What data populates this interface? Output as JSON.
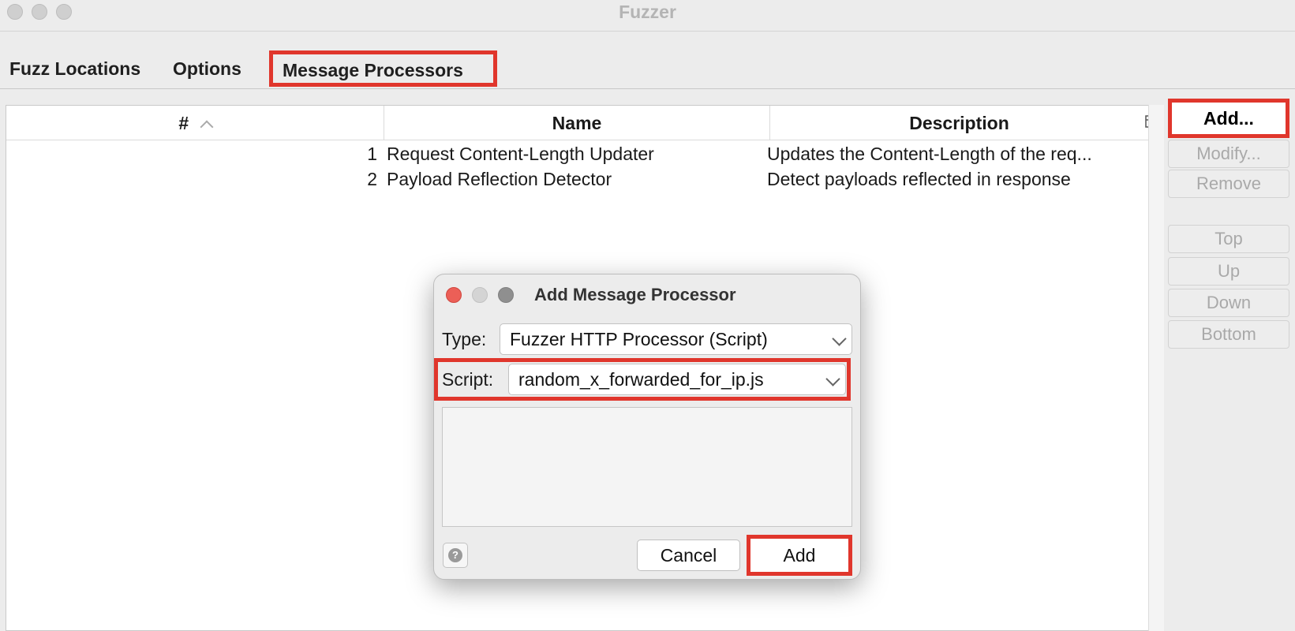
{
  "window": {
    "title": "Fuzzer"
  },
  "tabs": [
    "Fuzz Locations",
    "Options",
    "Message Processors"
  ],
  "table": {
    "columns": [
      "#",
      "Name",
      "Description"
    ],
    "sort_indicator": "^",
    "rows": [
      {
        "num": "1",
        "name": "Request Content-Length Updater",
        "description": "Updates the Content-Length of the req..."
      },
      {
        "num": "2",
        "name": "Payload Reflection Detector",
        "description": "Detect payloads reflected in response"
      }
    ]
  },
  "side_buttons": {
    "add": "Add...",
    "modify": "Modify...",
    "remove": "Remove",
    "top": "Top",
    "up": "Up",
    "down": "Down",
    "bottom": "Bottom"
  },
  "dialog": {
    "title": "Add Message Processor",
    "type_label": "Type:",
    "type_value": "Fuzzer HTTP Processor (Script)",
    "script_label": "Script:",
    "script_value": "random_x_forwarded_for_ip.js",
    "help_glyph": "?",
    "cancel_label": "Cancel",
    "add_label": "Add"
  },
  "colors": {
    "highlight": "#e0362c",
    "dialog_close": "#ec5f57"
  }
}
